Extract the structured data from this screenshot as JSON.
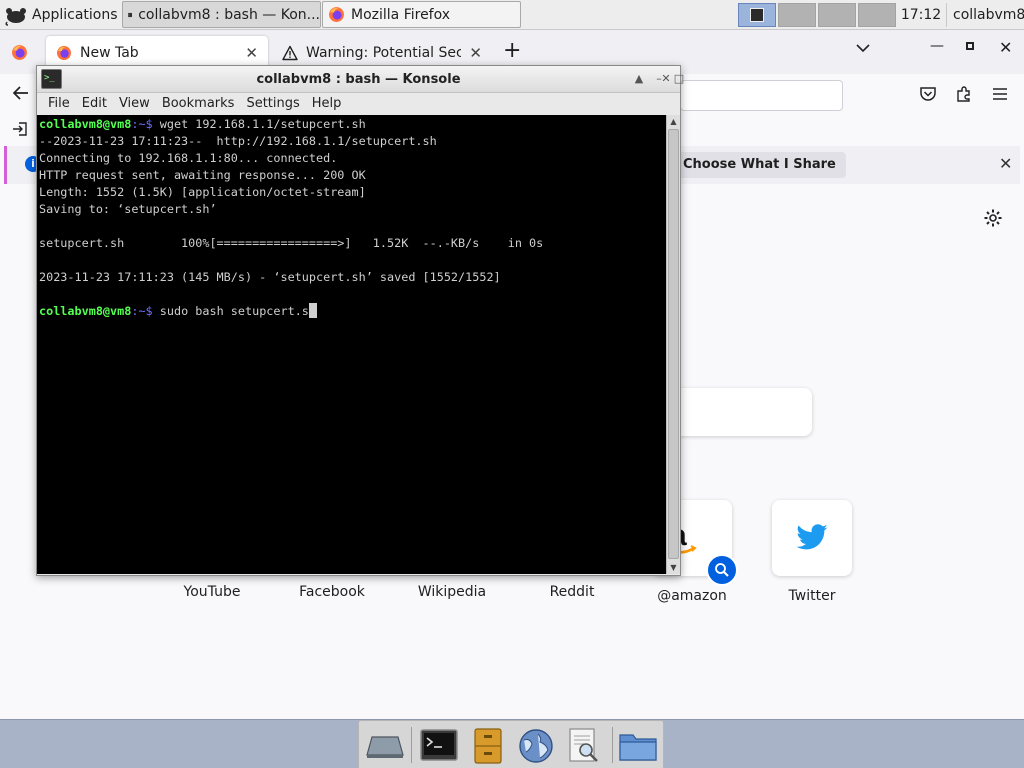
{
  "topbar": {
    "apps_label": "Applications",
    "tasks": [
      {
        "label": "collabvm8 : bash — Kon..."
      },
      {
        "label": "Mozilla Firefox"
      }
    ],
    "clock": "17:12",
    "user": "collabvm8"
  },
  "firefox": {
    "tabs": [
      {
        "label": "New Tab",
        "close": "✕"
      },
      {
        "label": "Warning: Potential Secur",
        "close": "✕"
      }
    ],
    "new_tab_label": "+",
    "notification_button": "Choose What I Share",
    "shortcuts": [
      {
        "label": "YouTube"
      },
      {
        "label": "Facebook"
      },
      {
        "label": "Wikipedia"
      },
      {
        "label": "Reddit"
      },
      {
        "label": "@amazon"
      },
      {
        "label": "Twitter"
      }
    ],
    "colors": {
      "accent": "#0060df",
      "twitter": "#1d9bf0",
      "amazon": "#ff9900"
    }
  },
  "konsole": {
    "title": "collabvm8 : bash — Konsole",
    "menu": [
      "File",
      "Edit",
      "View",
      "Bookmarks",
      "Settings",
      "Help"
    ],
    "prompt_user": "collabvm8@vm8",
    "prompt_path": ":~$",
    "lines": {
      "cmd1": " wget 192.168.1.1/setupcert.sh",
      "l2": "--2023-11-23 17:11:23--  http://192.168.1.1/setupcert.sh",
      "l3": "Connecting to 192.168.1.1:80... connected.",
      "l4": "HTTP request sent, awaiting response... 200 OK",
      "l5": "Length: 1552 (1.5K) [application/octet-stream]",
      "l6": "Saving to: ‘setupcert.sh’",
      "l7": "",
      "l8": "setupcert.sh        100%[=================>]   1.52K  --.-KB/s    in 0s",
      "l9": "",
      "l10": "2023-11-23 17:11:23 (145 MB/s) - ‘setupcert.sh’ saved [1552/1552]",
      "l11": "",
      "cmd2": " sudo bash setupcert.s"
    },
    "colors": {
      "prompt": "#54ff54",
      "path": "#6f6fff",
      "background": "#000000",
      "text": "#cfcfcf"
    }
  },
  "dock": {
    "items": [
      "show-desktop-icon",
      "terminal-icon",
      "file-cabinet-icon",
      "web-browser-icon",
      "search-files-icon",
      "folder-icon"
    ]
  }
}
